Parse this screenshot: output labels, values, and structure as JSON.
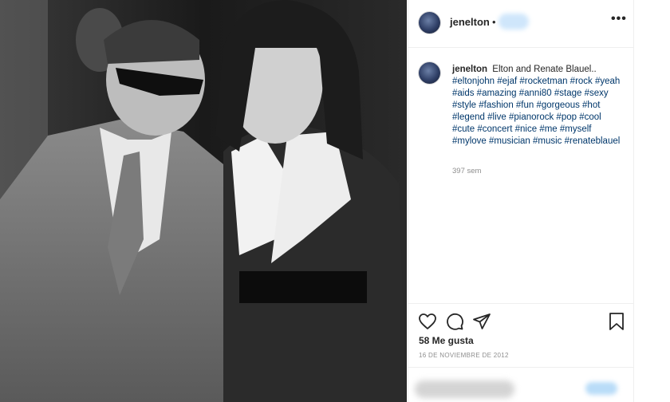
{
  "post": {
    "image": {
      "description": "black-and-white photo",
      "icon": "photo-image"
    },
    "header": {
      "username": "jenelton",
      "separator": "•",
      "more_icon": "more-horizontal-icon",
      "more_label": "•••"
    },
    "caption": {
      "username": "jenelton",
      "text": "Elton and Renate Blauel..",
      "hashtags": "#eltonjohn #ejaf #rocketman #rock #yeah #aids #amazing #anni80 #stage #sexy #style #fashion #fun #gorgeous #hot #legend #live #pianorock #pop #cool #cute #concert #nice #me #myself #mylove #musician #music #renateblauel",
      "age": "397 sem"
    },
    "actions": {
      "like_icon": "heart-icon",
      "comment_icon": "comment-icon",
      "share_icon": "share-icon",
      "save_icon": "bookmark-icon",
      "likes": "58 Me gusta",
      "date": "16 DE NOVIEMBRE DE 2012"
    }
  },
  "colors": {
    "text": "#262626",
    "hashtag": "#00376b",
    "muted": "#8e8e8e",
    "border": "#efefef"
  }
}
